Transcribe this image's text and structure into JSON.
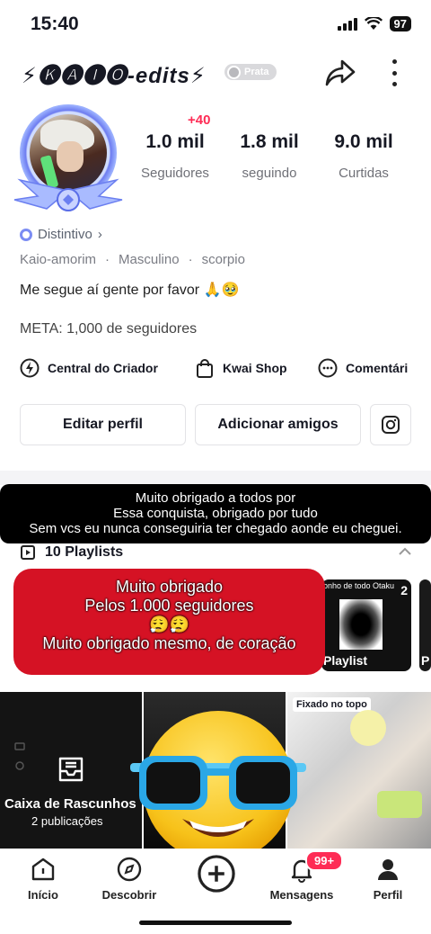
{
  "status_bar": {
    "time": "15:40",
    "battery": "97"
  },
  "header": {
    "username": "⚡🅚🅐🅘🅞-edits⚡",
    "level": "Prata"
  },
  "profile": {
    "new_followers": "+40",
    "stats": [
      {
        "value": "1.0 mil",
        "label": "Seguidores"
      },
      {
        "value": "1.8 mil",
        "label": "seguindo"
      },
      {
        "value": "9.0 mil",
        "label": "Curtidas"
      }
    ],
    "badge_label": "Distintivo",
    "details": [
      "Kaio-amorim",
      "Masculino",
      "scorpio"
    ],
    "bio": "Me segue aí gente por favor 🙏🥹",
    "goal": "META: 1,000 de seguidores"
  },
  "tools": [
    "Central do Criador",
    "Kwai Shop",
    "Comentári"
  ],
  "buttons": {
    "edit": "Editar perfil",
    "add": "Adicionar amigos"
  },
  "caption_black": [
    "Muito obrigado a todos por",
    "Essa conquista, obrigado por tudo",
    "Sem vcs eu nunca conseguiria ter chegado aonde eu cheguei."
  ],
  "playlists": {
    "label": "10 Playlists",
    "cards": [
      {
        "title": "onho de todo Otaku",
        "count": "2",
        "label": "Playlist"
      },
      {
        "label": "P"
      }
    ]
  },
  "caption_red": [
    "Muito obrigado",
    "Pelos 1.000 seguidores",
    "😮‍💨😮‍💨",
    "Muito obrigado mesmo, de coração"
  ],
  "grid": {
    "drafts_title": "Caixa de Rascunhos",
    "drafts_count": "2 publicações",
    "pinned_tag": "Fixado no topo"
  },
  "nav": {
    "items": [
      "Início",
      "Descobrir",
      "Mensagens",
      "Perfil"
    ],
    "badge": "99+"
  },
  "colors": {
    "accent": "#fe2c55",
    "red_caption": "#d51224",
    "level_badge": "#d9d9dc"
  }
}
